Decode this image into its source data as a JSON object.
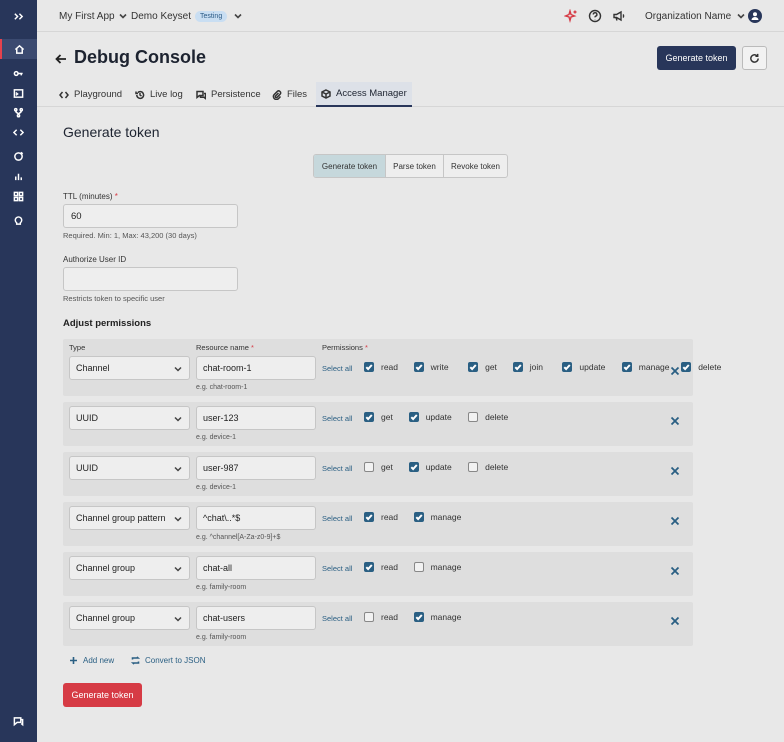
{
  "topbar": {
    "app_name": "My First App",
    "keyset": "Demo Keyset",
    "keyset_badge": "Testing",
    "org": "Organization Name"
  },
  "header": {
    "title": "Debug Console",
    "generate_label": "Generate token",
    "tabs": [
      {
        "label": "Playground",
        "icon": "code-icon"
      },
      {
        "label": "Live log",
        "icon": "history-icon"
      },
      {
        "label": "Persistence",
        "icon": "chat-icon"
      },
      {
        "label": "Files",
        "icon": "paperclip-icon"
      },
      {
        "label": "Access Manager",
        "icon": "cube-icon",
        "active": true
      }
    ]
  },
  "form": {
    "title": "Generate token",
    "mode_tabs": [
      "Generate token",
      "Parse token",
      "Revoke token"
    ],
    "ttl_label": "TTL (minutes)",
    "ttl_value": "60",
    "ttl_help": "Required. Min: 1, Max: 43,200 (30 days)",
    "auth_label": "Authorize User ID",
    "auth_value": "",
    "auth_help": "Restricts token to specific user",
    "adjust_label": "Adjust permissions",
    "col_type": "Type",
    "col_resource": "Resource name",
    "col_permissions": "Permissions",
    "select_all": "Select all",
    "add_new": "Add new",
    "convert_json": "Convert to JSON",
    "submit_label": "Generate token"
  },
  "permissions": [
    {
      "type": "Channel",
      "resource": "chat-room-1",
      "example": "e.g. chat-room-1",
      "perms": [
        {
          "label": "read",
          "checked": true
        },
        {
          "label": "write",
          "checked": true
        },
        {
          "label": "get",
          "checked": true
        },
        {
          "label": "join",
          "checked": true
        },
        {
          "label": "update",
          "checked": true
        },
        {
          "label": "manage",
          "checked": true
        },
        {
          "label": "delete",
          "checked": true
        }
      ]
    },
    {
      "type": "UUID",
      "resource": "user-123",
      "example": "e.g. device-1",
      "perms": [
        {
          "label": "get",
          "checked": true
        },
        {
          "label": "update",
          "checked": true
        },
        {
          "label": "delete",
          "checked": false
        }
      ]
    },
    {
      "type": "UUID",
      "resource": "user-987",
      "example": "e.g. device-1",
      "perms": [
        {
          "label": "get",
          "checked": false
        },
        {
          "label": "update",
          "checked": true
        },
        {
          "label": "delete",
          "checked": false
        }
      ]
    },
    {
      "type": "Channel group pattern",
      "resource": "^chat\\..*$",
      "example": "e.g. ^channel[A-Za-z0-9]+$",
      "perms": [
        {
          "label": "read",
          "checked": true
        },
        {
          "label": "manage",
          "checked": true
        }
      ]
    },
    {
      "type": "Channel group",
      "resource": "chat-all",
      "example": "e.g. family-room",
      "perms": [
        {
          "label": "read",
          "checked": true
        },
        {
          "label": "manage",
          "checked": false
        }
      ]
    },
    {
      "type": "Channel group",
      "resource": "chat-users",
      "example": "e.g. family-room",
      "perms": [
        {
          "label": "read",
          "checked": false
        },
        {
          "label": "manage",
          "checked": true
        }
      ]
    }
  ],
  "colors": {
    "primary": "#28365a",
    "accent": "#d63b45",
    "link": "#2a5f83"
  }
}
